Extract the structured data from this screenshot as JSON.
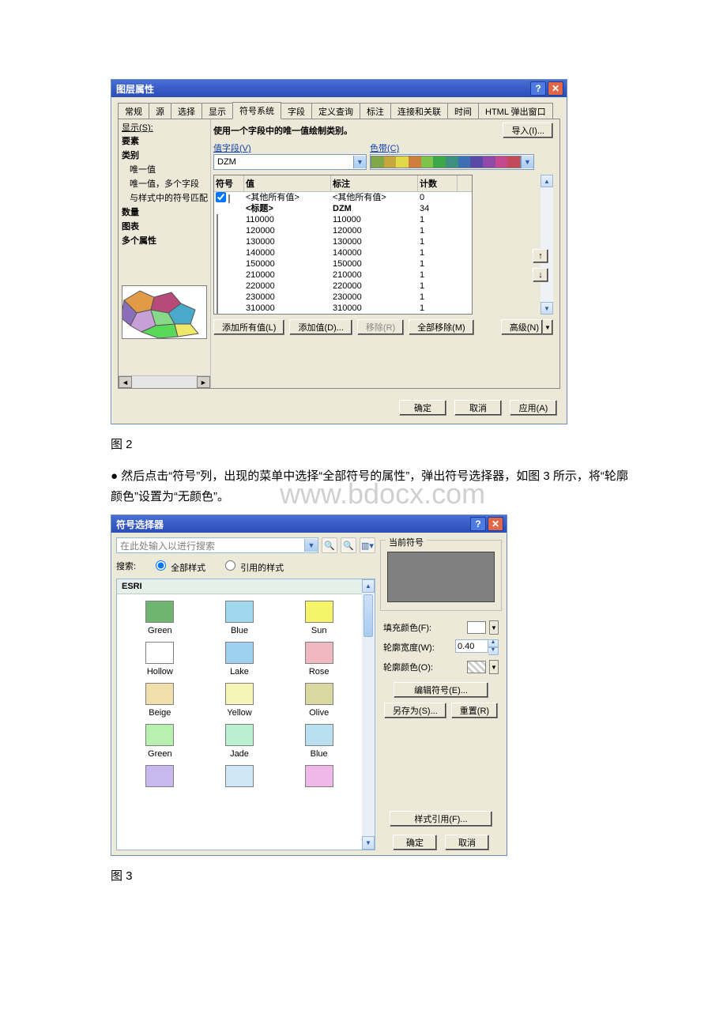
{
  "caption1": "图 2",
  "bodytext": "● 然后点击“符号”列，出现的菜单中选择“全部符号的属性”，弹出符号选择器，如图 3 所示，将“轮廓颜色”设置为“无颜色”。",
  "watermark": "www.bdocx.com",
  "caption2": "图 3",
  "dlg1": {
    "title": "图层属性",
    "tabs": [
      "常规",
      "源",
      "选择",
      "显示",
      "符号系统",
      "字段",
      "定义查询",
      "标注",
      "连接和关联",
      "时间",
      "HTML 弹出窗口"
    ],
    "active_tab_index": 4,
    "left": {
      "show_label": "显示(S):",
      "items": [
        {
          "t": "要素",
          "cls": "bold"
        },
        {
          "t": "类别",
          "cls": "bold"
        },
        {
          "t": "唯一值",
          "cls": "indent1"
        },
        {
          "t": "唯一值，多个字段",
          "cls": "indent1"
        },
        {
          "t": "与样式中的符号匹配",
          "cls": "indent1"
        },
        {
          "t": "数量",
          "cls": "bold"
        },
        {
          "t": "图表",
          "cls": "bold"
        },
        {
          "t": "多个属性",
          "cls": "bold"
        }
      ]
    },
    "desc": "使用一个字段中的唯一值绘制类别。",
    "import_btn": "导入(I)...",
    "value_field_label": "值字段(V)",
    "value_field_value": "DZM",
    "colorramp_label": "色带(C)",
    "ramp_colors": [
      "#7fa84a",
      "#c8a63e",
      "#e1d94a",
      "#cf7f3d",
      "#7fc34a",
      "#3da84a",
      "#3d8f7f",
      "#3d6fb5",
      "#5a4aa8",
      "#8f4aa8",
      "#c34a8f",
      "#c34a5a"
    ],
    "grid": {
      "headers": {
        "sym": "符号",
        "val": "值",
        "lbl": "标注",
        "cnt": "计数"
      },
      "rows": [
        {
          "c": "#ffffff",
          "v": "<其他所有值>",
          "l": "<其他所有值>",
          "n": "0",
          "chk": true
        },
        {
          "c": "",
          "v": "<标题>",
          "l": "DZM",
          "n": "34",
          "bold": true
        },
        {
          "c": "#7f3fa8",
          "v": "110000",
          "l": "110000",
          "n": "1"
        },
        {
          "c": "#4a6eb8",
          "v": "120000",
          "l": "120000",
          "n": "1"
        },
        {
          "c": "#8a8a3a",
          "v": "130000",
          "l": "130000",
          "n": "1"
        },
        {
          "c": "#b89a3a",
          "v": "140000",
          "l": "140000",
          "n": "1"
        },
        {
          "c": "#d84a9e",
          "v": "150000",
          "l": "150000",
          "n": "1"
        },
        {
          "c": "#2ad88a",
          "v": "210000",
          "l": "210000",
          "n": "1"
        },
        {
          "c": "#2ac8a8",
          "v": "220000",
          "l": "220000",
          "n": "1"
        },
        {
          "c": "#5ac85a",
          "v": "230000",
          "l": "230000",
          "n": "1"
        },
        {
          "c": "#8ac84a",
          "v": "310000",
          "l": "310000",
          "n": "1"
        }
      ]
    },
    "actions": {
      "add_all": "添加所有值(L)",
      "add_val": "添加值(D)...",
      "remove": "移除(R)",
      "remove_all": "全部移除(M)",
      "advanced": "高级(N)"
    },
    "ok": "确定",
    "cancel": "取消",
    "apply": "应用(A)"
  },
  "dlg2": {
    "title": "符号选择器",
    "search_placeholder": "在此处输入以进行搜索",
    "search_label": "搜索:",
    "radio_all": "全部样式",
    "radio_ref": "引用的样式",
    "list_header": "ESRI",
    "symbols": [
      {
        "name": "Green",
        "c": "#6fb56f"
      },
      {
        "name": "Blue",
        "c": "#a0d8f0"
      },
      {
        "name": "Sun",
        "c": "#f5f56a"
      },
      {
        "name": "Hollow",
        "c": "#ffffff"
      },
      {
        "name": "Lake",
        "c": "#9fd0f0"
      },
      {
        "name": "Rose",
        "c": "#f0b8c0"
      },
      {
        "name": "Beige",
        "c": "#f0dfa8"
      },
      {
        "name": "Yellow",
        "c": "#f5f5b8"
      },
      {
        "name": "Olive",
        "c": "#d8d8a0"
      },
      {
        "name": "Green",
        "c": "#b8f0b0"
      },
      {
        "name": "Jade",
        "c": "#b8f0d0"
      },
      {
        "name": "Blue",
        "c": "#b8e0f0"
      },
      {
        "name": "",
        "c": "#c8b8f0"
      },
      {
        "name": "",
        "c": "#d0e8f5"
      },
      {
        "name": "",
        "c": "#f0b8e8"
      }
    ],
    "right": {
      "current_symbol": "当前符号",
      "fill_label": "填充颜色(F):",
      "outline_w_label": "轮廓宽度(W):",
      "outline_w_value": "0.40",
      "outline_c_label": "轮廓颜色(O):",
      "edit_btn": "编辑符号(E)...",
      "saveas_btn": "另存为(S)...",
      "reset_btn": "重置(R)",
      "style_ref_btn": "样式引用(F)...",
      "ok": "确定",
      "cancel": "取消"
    }
  }
}
